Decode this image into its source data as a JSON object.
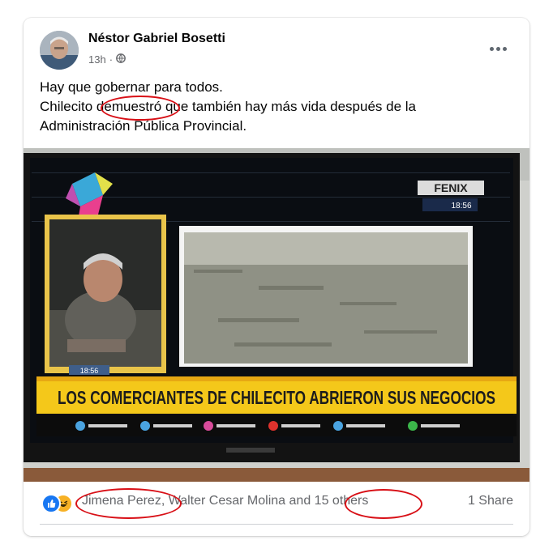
{
  "post": {
    "author": "Néstor Gabriel Bosetti",
    "time": "13h",
    "privacy_icon": "globe-icon",
    "text_lines": [
      "Hay que gobernar para todos.",
      "Chilecito demuestró que también hay más vida después de la",
      "Administración Pública Provincial."
    ]
  },
  "photo": {
    "tv_brand": "FENIX",
    "tv_time": "18:56",
    "inset_time": "18:56",
    "banner": "LOS COMERCIANTES DE CHILECITO ABRIERON SUS NEGOCIOS"
  },
  "footer": {
    "reactions": [
      "like-icon",
      "haha-icon"
    ],
    "name1": "Jimena Perez",
    "name2": "Walter Cesar Molina",
    "and_text": "and",
    "others": "15 others",
    "shares": "1 Share"
  },
  "colors": {
    "annotation_red": "#d80f16",
    "like_blue": "#1877f2",
    "haha_yellow": "#f7b125",
    "banner_yellow": "#f4c81a",
    "text_primary": "#050505",
    "text_secondary": "#65676b"
  }
}
